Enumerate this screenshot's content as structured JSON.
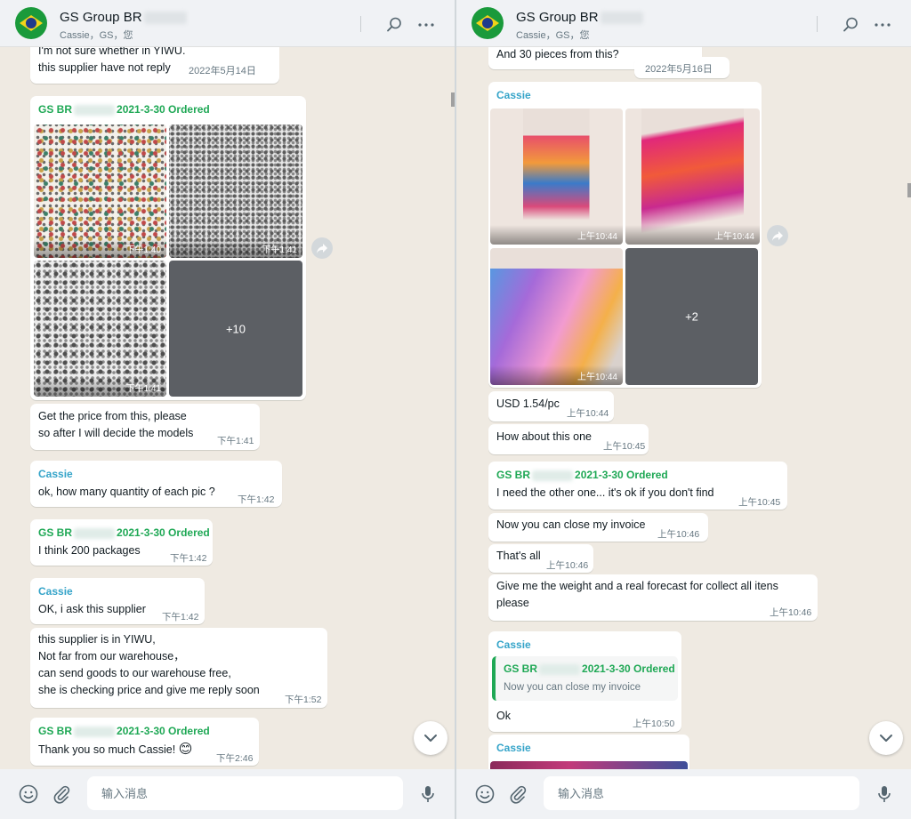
{
  "left": {
    "header": {
      "title": "GS Group BR",
      "subtitle": "Cassie，GS，您"
    },
    "messages": {
      "m1_line1": "I'm not sure whether in YIWU.",
      "m1_line2": "this supplier have not reply",
      "m1_time": "2022年5月14日",
      "m2_sender_a": "GS BR",
      "m2_sender_b": "2021-3-30 Ordered",
      "m2_img1_time": "下午1:40",
      "m2_img2_time": "下午1:41",
      "m2_img3_time": "下午1:41",
      "m2_more": "+10",
      "m3_line1": "Get the price from this, please",
      "m3_line2": "so after I will decide the models",
      "m3_time": "下午1:41",
      "m4_sender": "Cassie",
      "m4_text": "ok, how many quantity of each pic ?",
      "m4_time": "下午1:42",
      "m5_sender_a": "GS BR",
      "m5_sender_b": "2021-3-30 Ordered",
      "m5_text": "I think 200 packages",
      "m5_time": "下午1:42",
      "m6_sender": "Cassie",
      "m6_text": "OK, i ask this supplier",
      "m6_time": "下午1:42",
      "m7_line1": "this supplier is in YIWU,",
      "m7_line2": "Not far from our warehouse，",
      "m7_line3": "can send goods to our warehouse free,",
      "m7_line4": "she is checking price and give me reply soon",
      "m7_time": "下午1:52",
      "m8_sender_a": "GS BR",
      "m8_sender_b": "2021-3-30 Ordered",
      "m8_text": "Thank you so much Cassie!",
      "m8_emoji": "😊",
      "m8_time": "下午2:46"
    },
    "composer": {
      "placeholder": "输入消息"
    }
  },
  "right": {
    "header": {
      "title": "GS Group BR",
      "subtitle": "Cassie，GS，您"
    },
    "messages": {
      "m1_text": "And 30 pieces from this?",
      "m1_time": "2022年5月16日",
      "m2_sender": "Cassie",
      "m2_img1_time": "上午10:44",
      "m2_img2_time": "上午10:44",
      "m2_img3_time": "上午10:44",
      "m2_more": "+2",
      "m3_text": "USD 1.54/pc",
      "m3_time": "上午10:44",
      "m4_text": "How about this one",
      "m4_time": "上午10:45",
      "m5_sender_a": "GS BR",
      "m5_sender_b": "2021-3-30 Ordered",
      "m5_text": "I need the other one... it's ok if you don't find",
      "m5_time": "上午10:45",
      "m6_text": "Now you can close my invoice",
      "m6_time": "上午10:46",
      "m7_text": "That's all",
      "m7_time": "上午10:46",
      "m8_line1": "Give me the weight and a real forecast for collect all itens",
      "m8_line2": "please",
      "m8_time": "上午10:46",
      "m9_sender": "Cassie",
      "m9_quote_sender_a": "GS BR",
      "m9_quote_sender_b": "2021-3-30 Ordered",
      "m9_quote_text": "Now you can close my invoice",
      "m9_text": "Ok",
      "m9_time": "上午10:50",
      "m10_sender": "Cassie"
    },
    "composer": {
      "placeholder": "输入消息"
    }
  },
  "icons": {
    "avatar": "brazil-flag-avatar",
    "search": "search-icon",
    "menu": "more-icon",
    "forward": "forward-icon",
    "scroll_down": "chevron-down-icon",
    "emoji": "emoji-icon",
    "attach": "paperclip-icon",
    "mic": "microphone-icon"
  },
  "colors": {
    "chat_bg": "#efeae2",
    "header_bg": "#f0f2f5",
    "sender_green": "#1fa855",
    "sender_teal": "#35a4c9",
    "bubble_bg": "#ffffff"
  }
}
